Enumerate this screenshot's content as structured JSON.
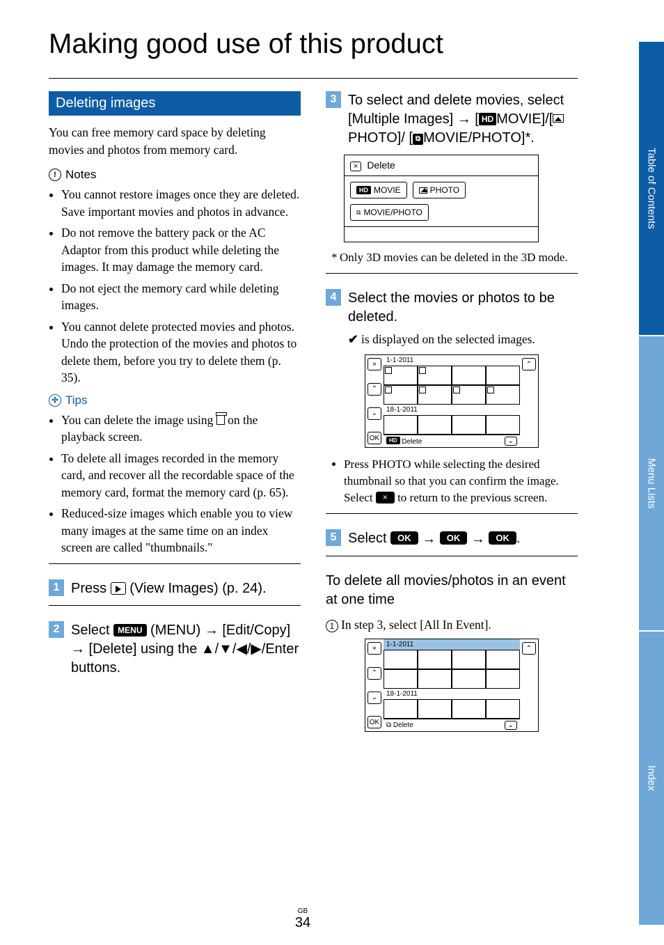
{
  "title": "Making good use of this product",
  "section": "Deleting images",
  "intro": "You can free memory card space by deleting movies and photos from memory card.",
  "notes_label": "Notes",
  "notes": [
    "You cannot restore images once they are deleted. Save important movies and photos in advance.",
    "Do not remove the battery pack or the AC Adaptor from this product while deleting the images. It may damage the memory card.",
    "Do not eject the memory card while deleting images.",
    "You cannot delete protected movies and photos. Undo the protection of the movies and photos to delete them, before you try to delete them (p. 35)."
  ],
  "tips_label": "Tips",
  "tips": [
    "You can delete the image using  on the playback screen.",
    "To delete all images recorded in the memory card, and recover all the recordable space of the memory card, format the memory card (p. 65).",
    "Reduced-size images which enable you to view many images at the same time on an index screen are called \"thumbnails.\""
  ],
  "steps": {
    "s1": "Press  (View Images) (p. 24).",
    "s2_a": "Select ",
    "s2_menu": "MENU",
    "s2_b": " (MENU) → [Edit/Copy] → [Delete] using the ▲/▼/◀/▶/Enter buttons.",
    "s3_a": "To select and delete movies, select [Multiple Images] → [",
    "s3_movie": "MOVIE",
    "s3_b": "]/[",
    "s3_photo": "PHOTO",
    "s3_c": "]/ [",
    "s3_mp": "MOVIE/PHOTO",
    "s3_d": "]*.",
    "s4": "Select the movies or photos to be deleted.",
    "s4_sub": " is displayed on the selected images.",
    "s5_a": "Select ",
    "s5_b": " → ",
    "s5_c": " → ",
    "s5_d": "."
  },
  "panel": {
    "title": "Delete",
    "btn_movie": "MOVIE",
    "btn_photo": "PHOTO",
    "btn_mp": "MOVIE/PHOTO"
  },
  "footnote": "Only 3D movies can be deleted in the 3D mode.",
  "thumb": {
    "date1": "1-1-2011",
    "date2": "18-1-2011",
    "ok": "OK",
    "delete": "Delete"
  },
  "press_photo_tip": "Press PHOTO while selecting the desired thumbnail so that you can confirm the image. Select  to return to the previous screen.",
  "ok_label": "OK",
  "subsection": "To delete all movies/photos in an event at one time",
  "substep": "In step 3, select [All In Event].",
  "tabs": [
    "Table of Contents",
    "Menu Lists",
    "Index"
  ],
  "page_gb": "GB",
  "page_num": "34"
}
